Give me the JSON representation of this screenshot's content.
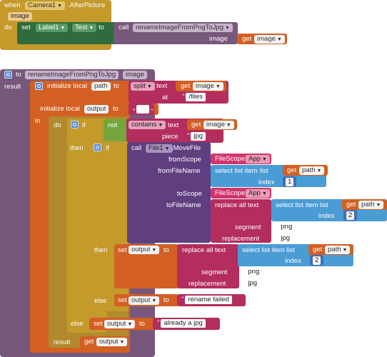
{
  "colors": {
    "event_gold": "#c49a2b",
    "procedure_purple": "#77587c",
    "variable_orange": "#d35f23",
    "text_pink": "#b32d5e",
    "list_blue": "#4a9cd5",
    "math_blue": "#3e6fb7",
    "logic_green": "#75a63b",
    "control_olive": "#b08a2d",
    "component_green": "#3b7a45",
    "file_purple": "#5f3f7f",
    "filescope_pink": "#d1356e"
  },
  "event": {
    "when": "when",
    "component": "Camera1",
    "event_name": ".AfterPicture",
    "param": "image",
    "do": "do",
    "set": "set",
    "set_component": "Label1",
    "set_property": "Text",
    "to": "to",
    "call": "call",
    "proc_name": "renameImageFromPngToJpg",
    "arg_label": "image",
    "get": "get",
    "get_var": "image"
  },
  "procedure": {
    "to": "to",
    "name": "renameImageFromPngToJpg",
    "param": "image",
    "result": "result",
    "init_local_1": "initialize local",
    "var_path": "path",
    "to2": "to",
    "split": "split",
    "split_text": "text",
    "get": "get",
    "split_get_var": "image",
    "split_at": "at",
    "split_at_value": "/files",
    "init_local_2": "initialize local",
    "var_output": "output",
    "to3": "to",
    "output_init": "",
    "in": "in",
    "do": "do",
    "if1": "if",
    "not": "not",
    "contains": "contains",
    "contains_text": "text",
    "contains_get_var": "image",
    "piece": "piece",
    "piece_value": "jpg",
    "then1": "then",
    "if2": "if",
    "call": "call",
    "file_comp": "File1",
    "movefile": ".MoveFile",
    "fromScope": "fromScope",
    "filescope": "FileScope",
    "filescope_val": "App",
    "fromFileName": "fromFileName",
    "select_list_item": "select list item",
    "list": "list",
    "get_path": "path",
    "index": "index",
    "index_val1": "1",
    "toScope": "toScope",
    "toFileName": "toFileName",
    "replace_all": "replace all text",
    "index_val2": "2",
    "segment": "segment",
    "segment_val": "png",
    "replacement": "replacement",
    "replacement_val": "jpg",
    "then2": "then",
    "set": "set",
    "set_var_output": "output",
    "to_lbl": "to",
    "else1": "else",
    "rename_failed": "rename failed",
    "else2": "else",
    "already_jpg": "already a jpg",
    "result2": "result",
    "get_output": "output"
  }
}
